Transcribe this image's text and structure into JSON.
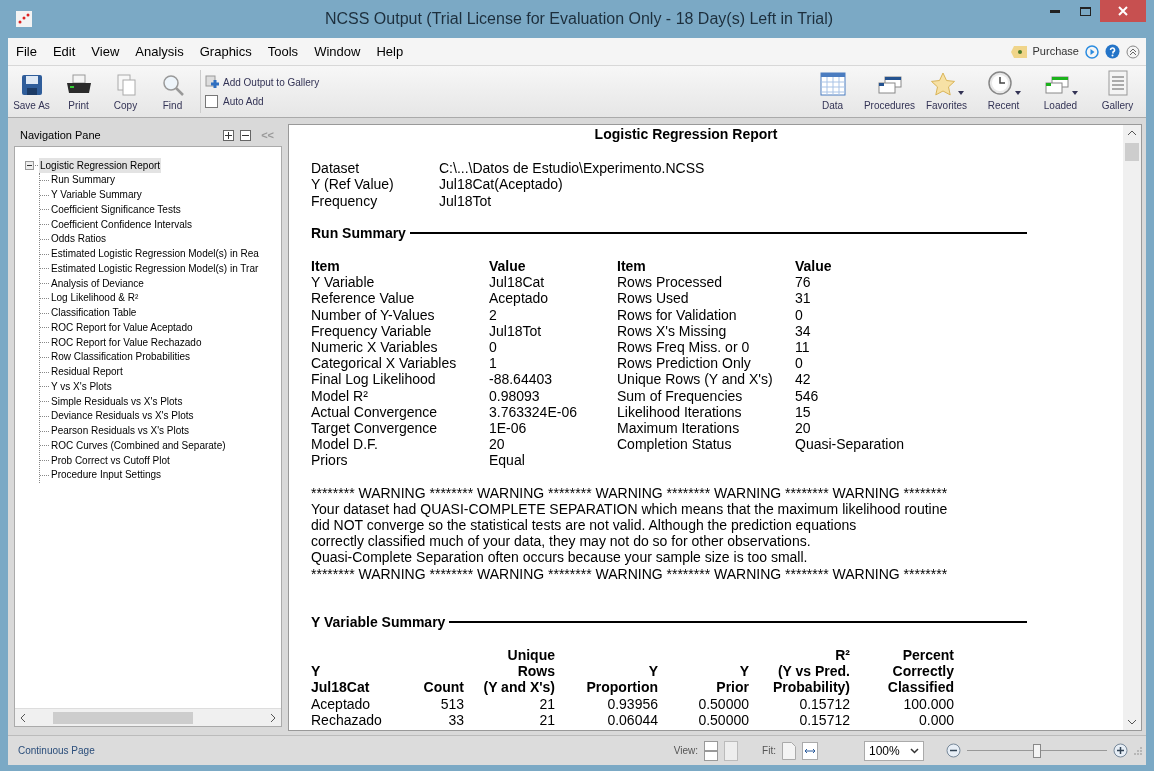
{
  "window": {
    "title": "NCSS Output (Trial License for Evaluation Only - 18 Day(s) Left in Trial)"
  },
  "menu": [
    "File",
    "Edit",
    "View",
    "Analysis",
    "Graphics",
    "Tools",
    "Window",
    "Help"
  ],
  "purchase": "Purchase",
  "toolbar_left": [
    {
      "label": "Save As",
      "kind": "save"
    },
    {
      "label": "Print",
      "kind": "print"
    },
    {
      "label": "Copy",
      "kind": "copy"
    },
    {
      "label": "Find",
      "kind": "find"
    }
  ],
  "add_output": "Add Output to Gallery",
  "auto_add": {
    "label": "Auto Add",
    "checked": false
  },
  "toolbar_right": [
    {
      "label": "Data",
      "kind": "data",
      "dropdown": false
    },
    {
      "label": "Procedures",
      "kind": "procedures",
      "dropdown": false
    },
    {
      "label": "Favorites",
      "kind": "favorites",
      "dropdown": true
    },
    {
      "label": "Recent",
      "kind": "recent",
      "dropdown": true
    },
    {
      "label": "Loaded",
      "kind": "loaded",
      "dropdown": true
    },
    {
      "label": "Gallery",
      "kind": "gallery",
      "dropdown": false
    }
  ],
  "nav": {
    "title": "Navigation Pane",
    "collapse": "<<",
    "tree": {
      "label": "Logistic Regression Report",
      "expanded": true,
      "selected": true,
      "children": [
        {
          "label": "Run Summary",
          "selected": false
        },
        {
          "label": "Y Variable Summary",
          "selected": false
        },
        {
          "label": "Coefficient Significance Tests",
          "selected": false
        },
        {
          "label": "Coefficient Confidence Intervals",
          "selected": false
        },
        {
          "label": "Odds Ratios",
          "selected": false
        },
        {
          "label": "Estimated Logistic Regression Model(s) in Rea",
          "selected": false
        },
        {
          "label": "Estimated Logistic Regression Model(s) in Trar",
          "selected": false
        },
        {
          "label": "Analysis of Deviance",
          "selected": false
        },
        {
          "label": "Log Likelihood & R²",
          "selected": false
        },
        {
          "label": "Classification Table",
          "selected": false
        },
        {
          "label": "ROC Report for Value Aceptado",
          "selected": false
        },
        {
          "label": "ROC Report for Value Rechazado",
          "selected": false
        },
        {
          "label": "Row Classification Probabilities",
          "selected": false
        },
        {
          "label": "Residual Report",
          "selected": false
        },
        {
          "label": "Y vs X's Plots",
          "selected": false
        },
        {
          "label": "Simple Residuals vs X's Plots",
          "selected": false
        },
        {
          "label": "Deviance Residuals vs X's Plots",
          "selected": false
        },
        {
          "label": "Pearson Residuals vs X's Plots",
          "selected": false
        },
        {
          "label": "ROC Curves (Combined and Separate)",
          "selected": false
        },
        {
          "label": "Prob Correct vs Cutoff Plot",
          "selected": false
        },
        {
          "label": "Procedure Input Settings",
          "selected": false
        }
      ]
    }
  },
  "report": {
    "title": "Logistic Regression Report",
    "info": [
      [
        "Dataset",
        "C:\\...\\Datos de Estudio\\Experimento.NCSS"
      ],
      [
        "Y (Ref Value)",
        "Jul18Cat(Aceptado)"
      ],
      [
        "Frequency",
        "Jul18Tot"
      ]
    ],
    "run_summary": {
      "heading": "Run Summary",
      "columns": [
        "Item",
        "Value",
        "Item",
        "Value"
      ],
      "rows": [
        [
          "Y Variable",
          "Jul18Cat",
          "Rows Processed",
          "76"
        ],
        [
          "Reference Value",
          "Aceptado",
          "Rows Used",
          "31"
        ],
        [
          "Number of Y-Values",
          "2",
          "Rows for Validation",
          "0"
        ],
        [
          "Frequency Variable",
          "Jul18Tot",
          "Rows X's Missing",
          "34"
        ],
        [
          "Numeric X Variables",
          "0",
          "Rows Freq Miss. or 0",
          "11"
        ],
        [
          "Categorical X Variables",
          "1",
          "Rows Prediction Only",
          "0"
        ],
        [
          "Final Log Likelihood",
          "-88.64403",
          "Unique Rows (Y and X's)",
          "42"
        ],
        [
          "Model R²",
          "0.98093",
          "Sum of Frequencies",
          "546"
        ],
        [
          "Actual Convergence",
          "3.763324E-06",
          "Likelihood Iterations",
          "15"
        ],
        [
          "Target Convergence",
          "1E-06",
          "Maximum Iterations",
          "20"
        ],
        [
          "Model D.F.",
          "20",
          "Completion Status",
          "Quasi-Separation"
        ],
        [
          "Priors",
          "Equal"
        ]
      ]
    },
    "warning": [
      "******** WARNING ******** WARNING ******** WARNING ******** WARNING ******** WARNING ********",
      "Your dataset had QUASI-COMPLETE SEPARATION which means that the maximum likelihood routine",
      "did NOT converge so the statistical tests are not valid. Although the prediction equations",
      "correctly classified much of your data, they may not do so for other observations.",
      "Quasi-Complete Separation often occurs because your sample size is too small.",
      "******** WARNING ******** WARNING ******** WARNING ******** WARNING ******** WARNING ********"
    ],
    "y_summary": {
      "heading": "Y Variable Summary",
      "header_rows": [
        [
          null,
          null,
          "Unique",
          null,
          null,
          "R²",
          "Percent"
        ],
        [
          "Y",
          null,
          "Rows",
          "Y",
          "Y",
          "(Y vs Pred.",
          "Correctly"
        ],
        [
          "Jul18Cat",
          "Count",
          "(Y and X's)",
          "Proportion",
          "Prior",
          "Probability)",
          "Classified"
        ]
      ],
      "rows": [
        [
          "Aceptado",
          "513",
          "21",
          "0.93956",
          "0.50000",
          "0.15712",
          "100.000"
        ],
        [
          "Rechazado",
          "33",
          "21",
          "0.06044",
          "0.50000",
          "0.15712",
          "0.000"
        ]
      ]
    }
  },
  "status": {
    "text": "Continuous Page",
    "view_label": "View:",
    "fit_label": "Fit:",
    "zoom": "100%",
    "zoom_slider": {
      "level": 0.5
    }
  }
}
